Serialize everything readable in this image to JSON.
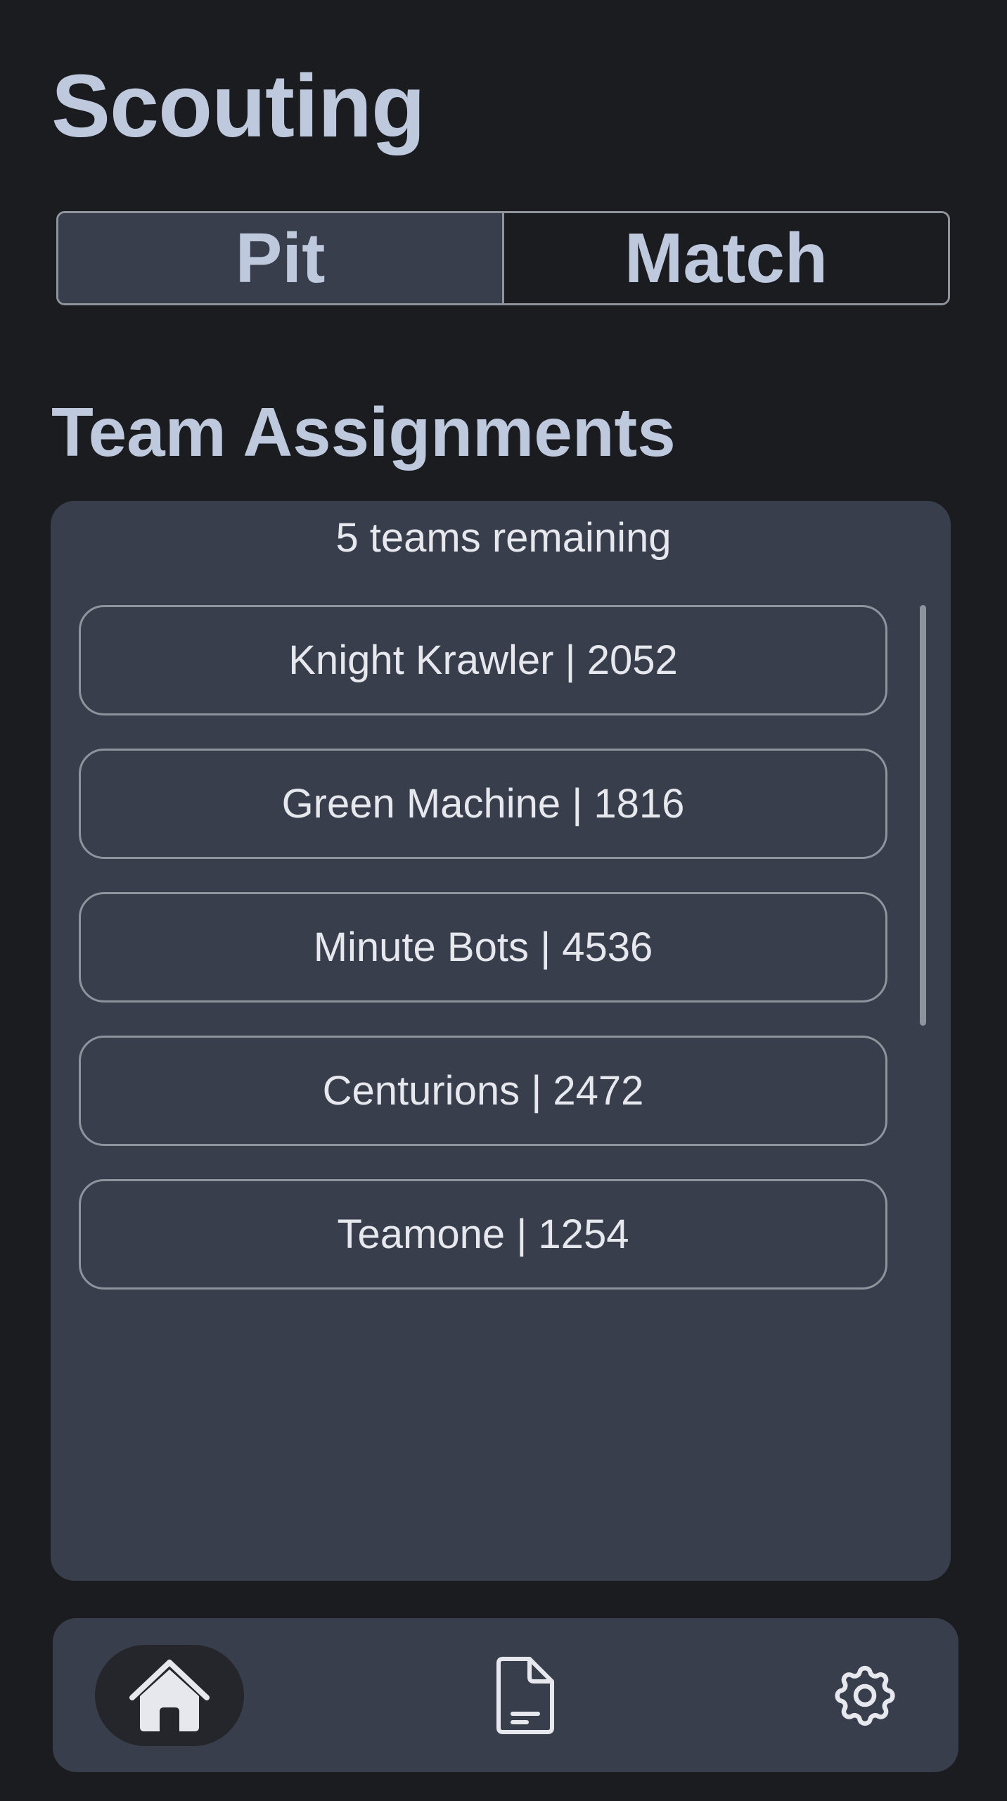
{
  "header": {
    "title": "Scouting"
  },
  "mode_toggle": {
    "options": [
      "Pit",
      "Match"
    ],
    "selected": "Pit"
  },
  "assignments": {
    "section_title": "Team Assignments",
    "remaining_text": "5 teams remaining",
    "teams": [
      "Knight Krawler | 2052",
      "Green Machine | 1816",
      "Minute Bots | 4536",
      "Centurions | 2472",
      "Teamone | 1254"
    ]
  },
  "nav": {
    "items": [
      {
        "icon": "home-icon",
        "active": true
      },
      {
        "icon": "document-icon",
        "active": false
      },
      {
        "icon": "gear-icon",
        "active": false
      }
    ]
  },
  "colors": {
    "background": "#1b1c1f",
    "surface": "#383e4b",
    "heading": "#bfc9de",
    "text": "#e6e8ee",
    "outline": "#8f949c"
  }
}
